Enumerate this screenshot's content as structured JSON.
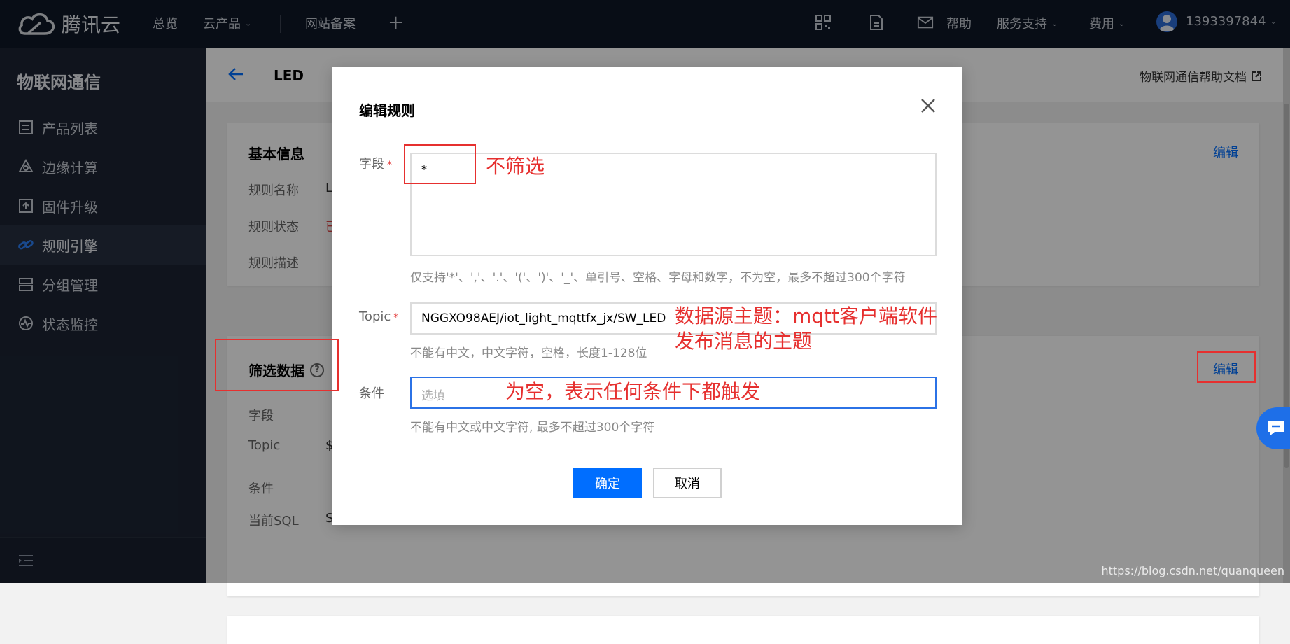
{
  "topnav": {
    "logo_text": "腾讯云",
    "items": [
      "总览",
      "云产品",
      "网站备案"
    ],
    "right_items": [
      "帮助",
      "服务支持",
      "费用"
    ],
    "account": "1393397844"
  },
  "sidebar": {
    "title": "物联网通信",
    "items": [
      {
        "label": "产品列表",
        "icon": "list-icon"
      },
      {
        "label": "边缘计算",
        "icon": "edge-icon"
      },
      {
        "label": "固件升级",
        "icon": "upload-icon"
      },
      {
        "label": "规则引擎",
        "icon": "link-icon",
        "active": true
      },
      {
        "label": "分组管理",
        "icon": "group-icon"
      },
      {
        "label": "状态监控",
        "icon": "monitor-icon"
      }
    ]
  },
  "page": {
    "title": "LED",
    "help_link": "物联网通信帮助文档",
    "basic_card": {
      "title": "基本信息",
      "edit": "编辑",
      "rows": [
        {
          "label": "规则名称",
          "value": "LE"
        },
        {
          "label": "规则状态",
          "value": "已"
        },
        {
          "label": "规则描述",
          "value": ""
        }
      ]
    },
    "filter_card": {
      "title": "筛选数据",
      "edit": "编辑",
      "rows": [
        {
          "label": "字段",
          "value": ""
        },
        {
          "label": "Topic",
          "value": "$("
        },
        {
          "label": "条件",
          "value": ""
        },
        {
          "label": "当前SQL",
          "value": "SE"
        }
      ]
    }
  },
  "dialog": {
    "title": "编辑规则",
    "field_label": "字段",
    "field_value": "*",
    "field_hint": "仅支持'*'、','、'.'、'('、')'、'_'、单引号、空格、字母和数字，不为空，最多不超过300个字符",
    "topic_label": "Topic",
    "topic_value": "NGGXO98AEJ/iot_light_mqttfx_jx/SW_LED",
    "topic_hint": "不能有中文，中文字符，空格，长度1-128位",
    "condition_label": "条件",
    "condition_placeholder": "选填",
    "condition_hint": "不能有中文或中文字符, 最多不超过300个字符",
    "confirm": "确定",
    "cancel": "取消"
  },
  "annotations": {
    "field": "不筛选",
    "topic_line1": "数据源主题：mqtt客户端软件",
    "topic_line2": "发布消息的主题",
    "condition": "为空，表示任何条件下都触发"
  },
  "watermark": "https://blog.csdn.net/quanqueen",
  "colors": {
    "accent": "#006eff",
    "annotation": "#e6302f",
    "nav_bg": "#0f1727",
    "sidebar_bg": "#1c2433"
  }
}
